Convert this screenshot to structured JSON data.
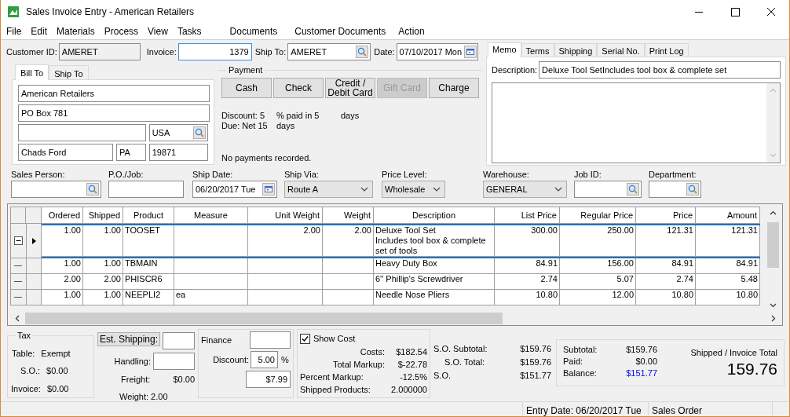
{
  "window": {
    "title": "Sales Invoice Entry - American Retailers"
  },
  "menu": [
    "File",
    "Edit",
    "Materials",
    "Process",
    "View",
    "Tasks",
    "Documents",
    "Customer Documents",
    "Action"
  ],
  "header": [
    {
      "label": "Customer ID:",
      "value": "AMERET",
      "kind": "readonly"
    },
    {
      "label": "Invoice:",
      "value": "1379",
      "kind": "focused"
    },
    {
      "label": "Ship To:",
      "value": "AMERET",
      "kind": "lookup"
    },
    {
      "label": "Date:",
      "value": "07/10/2017 Mon",
      "kind": "date"
    }
  ],
  "address_tabs": [
    {
      "label": "Bill To",
      "selected": true
    },
    {
      "label": "Ship To",
      "selected": false
    }
  ],
  "address": {
    "name": "American Retailers",
    "street": "PO Box 781",
    "country": "USA",
    "city": "Chads Ford",
    "state": "PA",
    "zip": "19871"
  },
  "payment": {
    "title": "Payment",
    "buttons": [
      {
        "label": "Cash",
        "disabled": false
      },
      {
        "label": "Check",
        "disabled": false
      },
      {
        "label": "Credit / Debit Card",
        "disabled": false
      },
      {
        "label": "Gift Card",
        "disabled": true
      },
      {
        "label": "Charge",
        "disabled": false
      }
    ],
    "terms": [
      [
        "Discount: 5",
        "% paid in 5",
        "days"
      ],
      [
        "Due: Net 15",
        "days"
      ]
    ],
    "status": "No payments recorded."
  },
  "memo_tabs": [
    {
      "label": "Memo",
      "selected": true
    },
    {
      "label": "Terms",
      "selected": false
    },
    {
      "label": "Shipping",
      "selected": false
    },
    {
      "label": "Serial No.",
      "selected": false
    },
    {
      "label": "Print Log",
      "selected": false
    }
  ],
  "memo": {
    "description_label": "Description:",
    "description": "Deluxe Tool SetIncludes tool box & complete set"
  },
  "order_fields": [
    {
      "label": "Sales Person:",
      "kind": "lookup"
    },
    {
      "label": "P.O./Job:",
      "kind": "text"
    },
    {
      "label": "Ship Date:",
      "value": "06/20/2017 Tue",
      "kind": "date"
    },
    {
      "label": "Ship Via:",
      "value": "Route A",
      "kind": "dropdown"
    },
    {
      "label": "Price Level:",
      "value": "Wholesale",
      "kind": "dropdown"
    },
    {
      "label": "Warehouse:",
      "value": "GENERAL",
      "kind": "dropdown"
    },
    {
      "label": "Job ID:",
      "kind": "lookup"
    },
    {
      "label": "Department:",
      "kind": "lookup"
    }
  ],
  "table": {
    "columns": [
      "Ordered",
      "Shipped",
      "Product",
      "Measure",
      "Unit Weight",
      "Weight",
      "Description",
      "List Price",
      "Regular Price",
      "Price",
      "Amount"
    ],
    "rows": [
      {
        "selected": true,
        "expanded": true,
        "cells": [
          "1.00",
          "1.00",
          "TOOSET",
          "",
          "2.00",
          "2.00",
          "Deluxe Tool Set\nIncludes tool box & complete set of tools",
          "300.00",
          "250.00",
          "121.31",
          "121.31"
        ]
      },
      {
        "selected": false,
        "cells": [
          "1.00",
          "1.00",
          "TBMAIN",
          "",
          "",
          "",
          "Heavy Duty Box",
          "84.91",
          "156.00",
          "84.91",
          "84.91"
        ]
      },
      {
        "selected": false,
        "cells": [
          "2.00",
          "2.00",
          "PHISCR6",
          "",
          "",
          "",
          "6'' Phillip's Screwdriver",
          "2.74",
          "5.07",
          "2.74",
          "5.48"
        ]
      },
      {
        "selected": false,
        "cells": [
          "1.00",
          "1.00",
          "NEEPLI2",
          "ea",
          "",
          "",
          "Needle Nose Pliers",
          "10.80",
          "12.00",
          "10.80",
          "10.80"
        ]
      }
    ]
  },
  "tax": {
    "title": "Tax",
    "rows": [
      {
        "label": "Table:",
        "value": "Exempt"
      },
      {
        "label": "S.O.:",
        "value": "$0.00"
      },
      {
        "label": "Invoice:",
        "value": "$0.00"
      }
    ]
  },
  "shipping": {
    "est_button": "Est. Shipping:",
    "handling_label": "Handling:",
    "freight": {
      "label": "Freight:",
      "value": "$0.00"
    },
    "weight": {
      "label": "Weight:",
      "value": "2.00"
    }
  },
  "finance": {
    "label": "Finance",
    "discount_label": "Discount:",
    "discount": "5.00",
    "percent": "%",
    "amount": "$7.99"
  },
  "cost": {
    "show_cost": {
      "label": "Show Cost",
      "checked": true
    },
    "rows": [
      {
        "label": "Costs:",
        "value": "$182.54"
      },
      {
        "label": "Total Markup:",
        "value": "$-22.78"
      },
      {
        "label": "Percent Markup:",
        "value": "-12.5%"
      },
      {
        "label": "Shipped Products:",
        "value": "2.000000"
      }
    ]
  },
  "so_totals": [
    {
      "label": "S.O. Subtotal:",
      "value": "$159.76"
    },
    {
      "label": "S.O. Total:",
      "value": "$159.76"
    },
    {
      "label": "S.O.",
      "value": "$151.77"
    }
  ],
  "totals": {
    "rows": [
      {
        "label": "Subtotal:",
        "value": "$159.76",
        "highlight": false
      },
      {
        "label": "Paid:",
        "value": "$0.00",
        "highlight": false
      },
      {
        "label": "Balance:",
        "value": "$151.77",
        "highlight": true
      }
    ],
    "caption": "Shipped / Invoice Total",
    "total": "159.76"
  },
  "status_bar": [
    "Entry Date: 06/20/2017 Tue",
    "Sales Order"
  ]
}
